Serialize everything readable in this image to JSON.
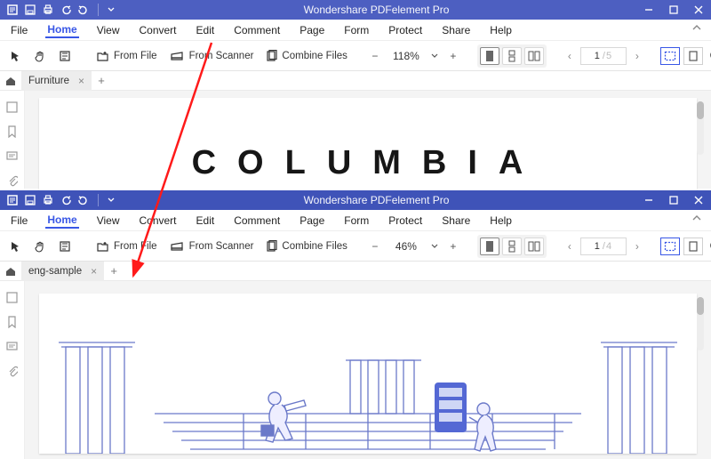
{
  "window1": {
    "title": "Wondershare PDFelement Pro",
    "menu": [
      "File",
      "Home",
      "View",
      "Convert",
      "Edit",
      "Comment",
      "Page",
      "Form",
      "Protect",
      "Share",
      "Help"
    ],
    "active_menu_index": 1,
    "toolbar": {
      "from_file": "From File",
      "from_scanner": "From Scanner",
      "combine": "Combine Files",
      "zoom": "118%",
      "page_cur": "1",
      "page_total": "/5"
    },
    "tab": {
      "name": "Furniture"
    },
    "doc_heading": "COLUMBIA"
  },
  "window2": {
    "title": "Wondershare PDFelement Pro",
    "menu": [
      "File",
      "Home",
      "View",
      "Convert",
      "Edit",
      "Comment",
      "Page",
      "Form",
      "Protect",
      "Share",
      "Help"
    ],
    "active_menu_index": 1,
    "toolbar": {
      "from_file": "From File",
      "from_scanner": "From Scanner",
      "combine": "Combine Files",
      "zoom": "46%",
      "page_cur": "1",
      "page_total": "/4"
    },
    "tab": {
      "name": "eng-sample"
    }
  }
}
